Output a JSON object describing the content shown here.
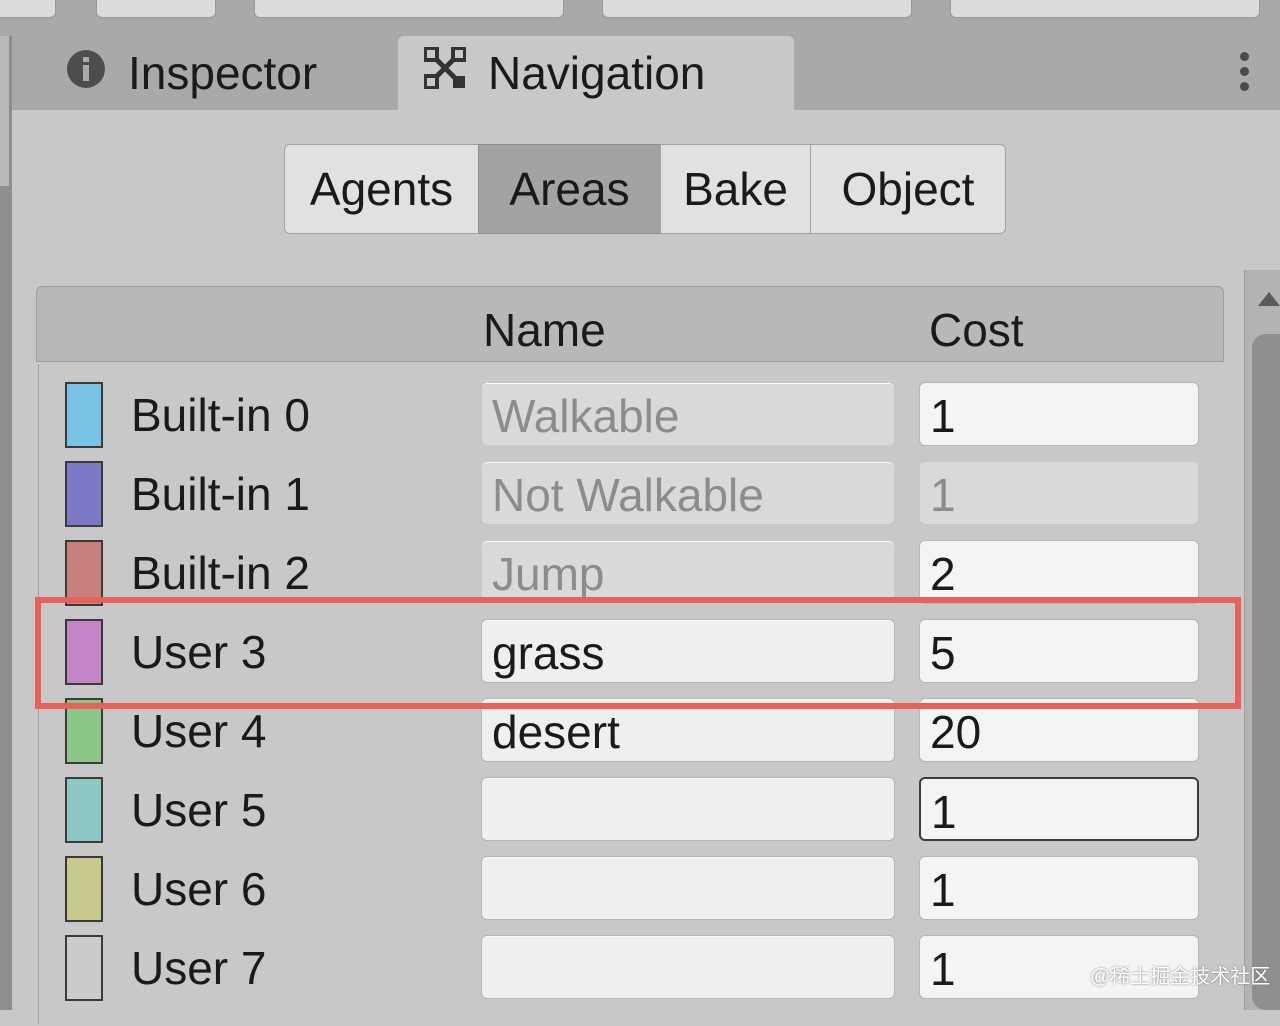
{
  "window_tabs": [
    {
      "label": "Inspector",
      "icon": "info-icon",
      "active": false
    },
    {
      "label": "Navigation",
      "icon": "navmesh-icon",
      "active": true
    }
  ],
  "nav_tabs": [
    "Agents",
    "Areas",
    "Bake",
    "Object"
  ],
  "active_nav_tab": "Areas",
  "table": {
    "headers": {
      "name": "Name",
      "cost": "Cost"
    },
    "rows": [
      {
        "label": "Built-in 0",
        "color": "#79c4e6",
        "name": "Walkable",
        "cost": "1",
        "name_disabled": true,
        "cost_disabled": false
      },
      {
        "label": "Built-in 1",
        "color": "#7b79c6",
        "name": "Not Walkable",
        "cost": "1",
        "name_disabled": true,
        "cost_disabled": true
      },
      {
        "label": "Built-in 2",
        "color": "#c6817f",
        "name": "Jump",
        "cost": "2",
        "name_disabled": true,
        "cost_disabled": false
      },
      {
        "label": "User 3",
        "color": "#c385c8",
        "name": "grass",
        "cost": "5",
        "name_disabled": false,
        "cost_disabled": false,
        "highlighted": true
      },
      {
        "label": "User 4",
        "color": "#8cc687",
        "name": "desert",
        "cost": "20",
        "name_disabled": false,
        "cost_disabled": false
      },
      {
        "label": "User 5",
        "color": "#8ec8c6",
        "name": "",
        "cost": "1",
        "name_disabled": false,
        "cost_disabled": false,
        "cost_focused": true
      },
      {
        "label": "User 6",
        "color": "#c8c98c",
        "name": "",
        "cost": "1",
        "name_disabled": false,
        "cost_disabled": false
      },
      {
        "label": "User 7",
        "color": "#cbcbcb",
        "name": "",
        "cost": "1",
        "name_disabled": false,
        "cost_disabled": false
      }
    ]
  },
  "highlight_color": "#e8625b",
  "watermark": "@稀土掘金技术社区"
}
